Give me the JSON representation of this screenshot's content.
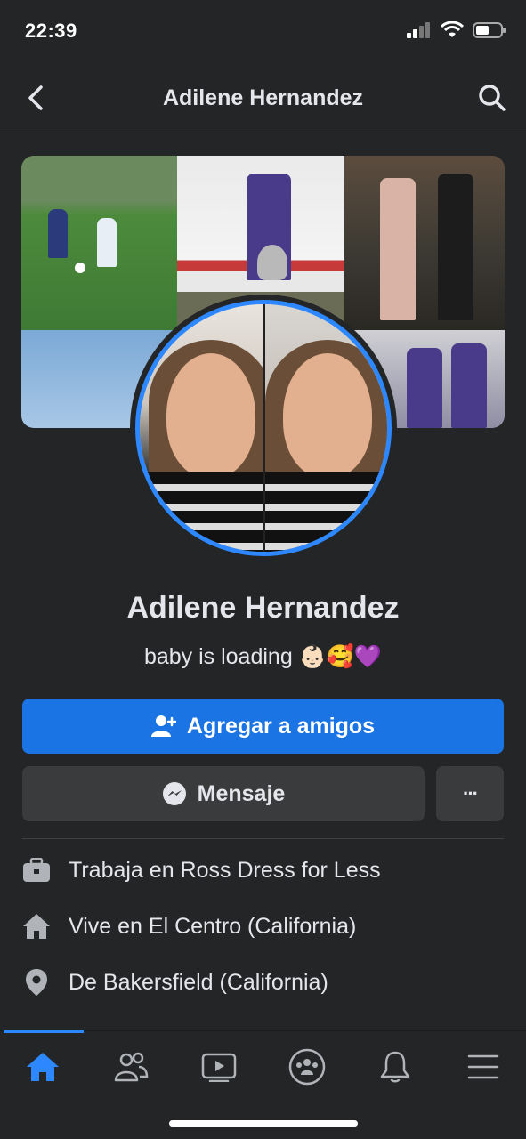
{
  "status_bar": {
    "time": "22:39"
  },
  "header": {
    "title": "Adilene Hernandez"
  },
  "profile": {
    "name": "Adilene Hernandez",
    "bio": "baby is loading 👶🏻🥰💜"
  },
  "actions": {
    "add_friend_label": "Agregar a amigos",
    "message_label": "Mensaje",
    "more_label": "···"
  },
  "about": [
    {
      "icon": "briefcase-icon",
      "prefix": "Trabaja en ",
      "value": "Ross Dress for Less"
    },
    {
      "icon": "home-icon",
      "prefix": "Vive en ",
      "value": "El Centro (California)"
    },
    {
      "icon": "location-pin-icon",
      "prefix": "De ",
      "value": "Bakersfield (California)"
    }
  ],
  "tab_bar": {
    "tabs": [
      "home",
      "friends",
      "watch",
      "groups",
      "notifications",
      "menu"
    ],
    "active": "home"
  },
  "colors": {
    "accent": "#2d88ff",
    "button_primary": "#1b74e4",
    "background": "#242526",
    "button_secondary": "#3a3b3c"
  }
}
